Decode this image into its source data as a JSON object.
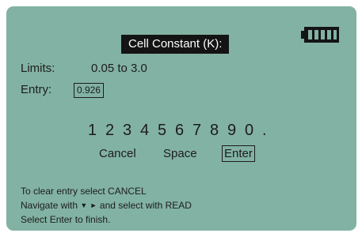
{
  "screen": {
    "title": "Cell Constant (K):",
    "battery_icon": "battery-full-icon",
    "colors": {
      "background": "#82b2a3",
      "text": "#1c1c1c",
      "title_background": "#141414",
      "title_text": "#ffffff"
    }
  },
  "limits": {
    "label": "Limits:",
    "value": "0.05 to 3.0"
  },
  "entry": {
    "label": "Entry:",
    "value": "0.926"
  },
  "keypad": {
    "keys": [
      "1",
      "2",
      "3",
      "4",
      "5",
      "6",
      "7",
      "8",
      "9",
      "0",
      "."
    ],
    "actions": [
      "Cancel",
      "Space",
      "Enter"
    ],
    "selected_action": "Enter"
  },
  "help": {
    "line1_text": "To clear entry select ",
    "line1_keyword": "CANCEL",
    "line2_prefix": "Navigate with ",
    "line2_down_icon": "▼",
    "line2_right_icon": "►",
    "line2_middle": " and select with ",
    "line2_keyword": "READ",
    "line3_prefix": "Select ",
    "line3_keyword": "Enter",
    "line3_suffix": " to finish."
  }
}
